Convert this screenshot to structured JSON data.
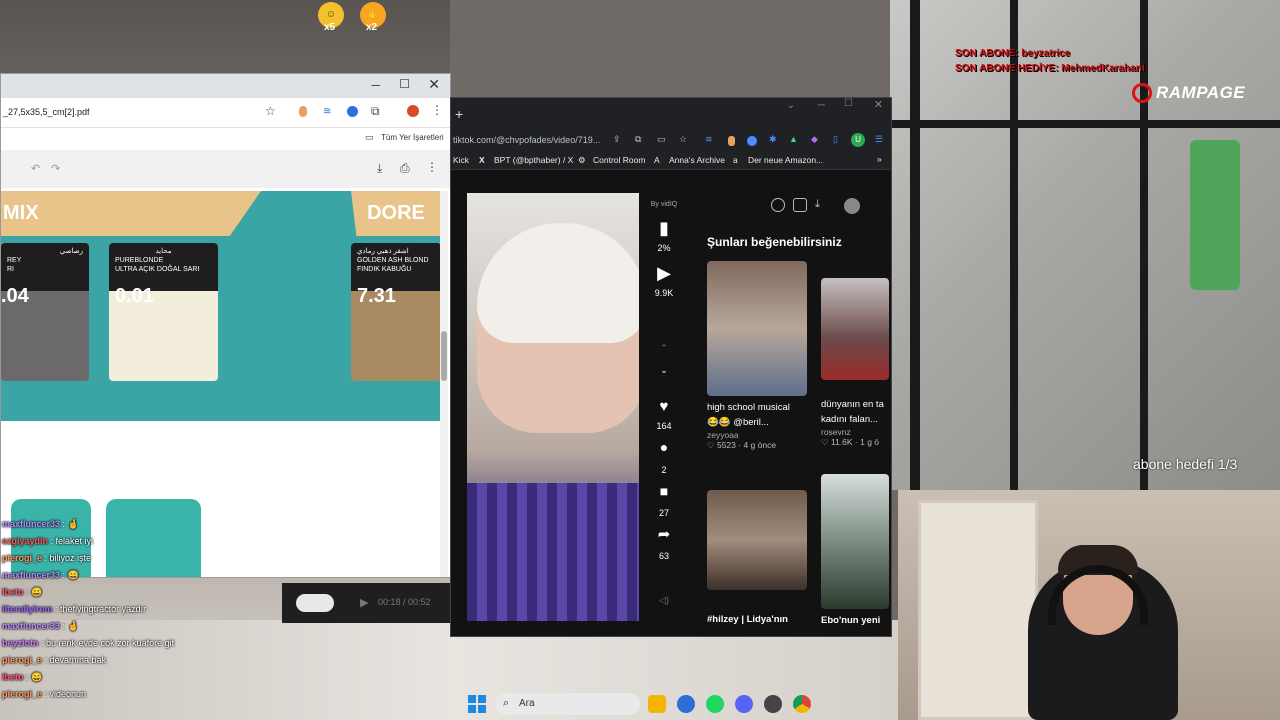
{
  "overlay": {
    "emote1_count": "x5",
    "emote2_count": "x2",
    "sub_line1": "SON ABONE: beyzatrice",
    "sub_line2": "SON ABONE HEDİYE: MehmedKarahani",
    "brand": "RAMPAGE",
    "sub_goal": "abone hedefi 1/3"
  },
  "pdf_window": {
    "tab_url": "_27,5x35,5_cm[2].pdf",
    "bookmarks_label": "Tüm Yer İşaretleri",
    "banner_left": "MIX",
    "banner_right": "DORE",
    "swatches": [
      {
        "arabic": "رصاصي",
        "line1": "REY",
        "line2": "RI",
        "number": ".04",
        "color": "#6a6a6a"
      },
      {
        "arabic": "محايد",
        "line1": "PUREBLONDE",
        "line2": "ULTRA AÇIK DOĞAL SARI",
        "number": "0.01",
        "color": "#f0ecd8"
      },
      {
        "arabic": "اشقر ذهبي رمادي",
        "line1": "GOLDEN ASH BLOND",
        "line2": "FINDIK KABUĞU",
        "number": "7.31",
        "color": "#a98a62"
      }
    ]
  },
  "tiktok_window": {
    "url": "tiktok.com/@chvpofades/video/719...",
    "bookmarks": [
      "Kick",
      "BPT (@bpthaber) / X",
      "Control Room",
      "Anna's Archive",
      "Der neue Amazon..."
    ],
    "by_label": "By vidIQ",
    "stat_percent": "2%",
    "views": "9.9K",
    "likes": "164",
    "comments": "2",
    "saves": "27",
    "shares": "63",
    "playback_time": "00:18 / 00:52",
    "recommend_title": "Şunları beğenebilirsiniz",
    "cards": [
      {
        "title1": "high school musical",
        "title2": "😂😂 @beril...",
        "user": "zeyyoaa",
        "meta": "♡ 5523 · 4 g önce"
      },
      {
        "title1": "dünyanın en ta",
        "title2": "kadını falan...",
        "user": "rosevnz",
        "meta": "♡ 11.6K · 1 g ö"
      },
      {
        "title1": "#hilzey | Lidya'nın",
        "title2": "",
        "user": "",
        "meta": ""
      },
      {
        "title1": "Ebo'nun yeni",
        "title2": "",
        "user": "",
        "meta": ""
      }
    ]
  },
  "chat": [
    {
      "user": "maxfluncer33",
      "msg": "🤞",
      "color": "#b98cff"
    },
    {
      "user": "ezgiyaydin",
      "msg": "felaket iyi",
      "color": "#ff5a5a"
    },
    {
      "user": "pierogi_e",
      "msg": "biliyoz işte",
      "color": "#ff9966"
    },
    {
      "user": "maxfluncer33",
      "msg": "😄",
      "color": "#b98cff"
    },
    {
      "user": "lbeto",
      "msg": "😄",
      "color": "#ff5577"
    },
    {
      "user": "literallyirem",
      "msg": "theflyingtractor yazdır",
      "color": "#9966ff"
    },
    {
      "user": "maxfluncer33",
      "msg": "🤞",
      "color": "#b98cff"
    },
    {
      "user": "beyzlotn",
      "msg": "bu renk evde cok zor kuafore git",
      "color": "#cc77ff"
    },
    {
      "user": "pierogi_e",
      "msg": "devamına bak",
      "color": "#ff9966"
    },
    {
      "user": "lbeto",
      "msg": "😄",
      "color": "#ff5577"
    },
    {
      "user": "pierogi_e",
      "msg": "videonun",
      "color": "#ff9966"
    }
  ],
  "taskbar": {
    "search_placeholder": "Ara"
  }
}
